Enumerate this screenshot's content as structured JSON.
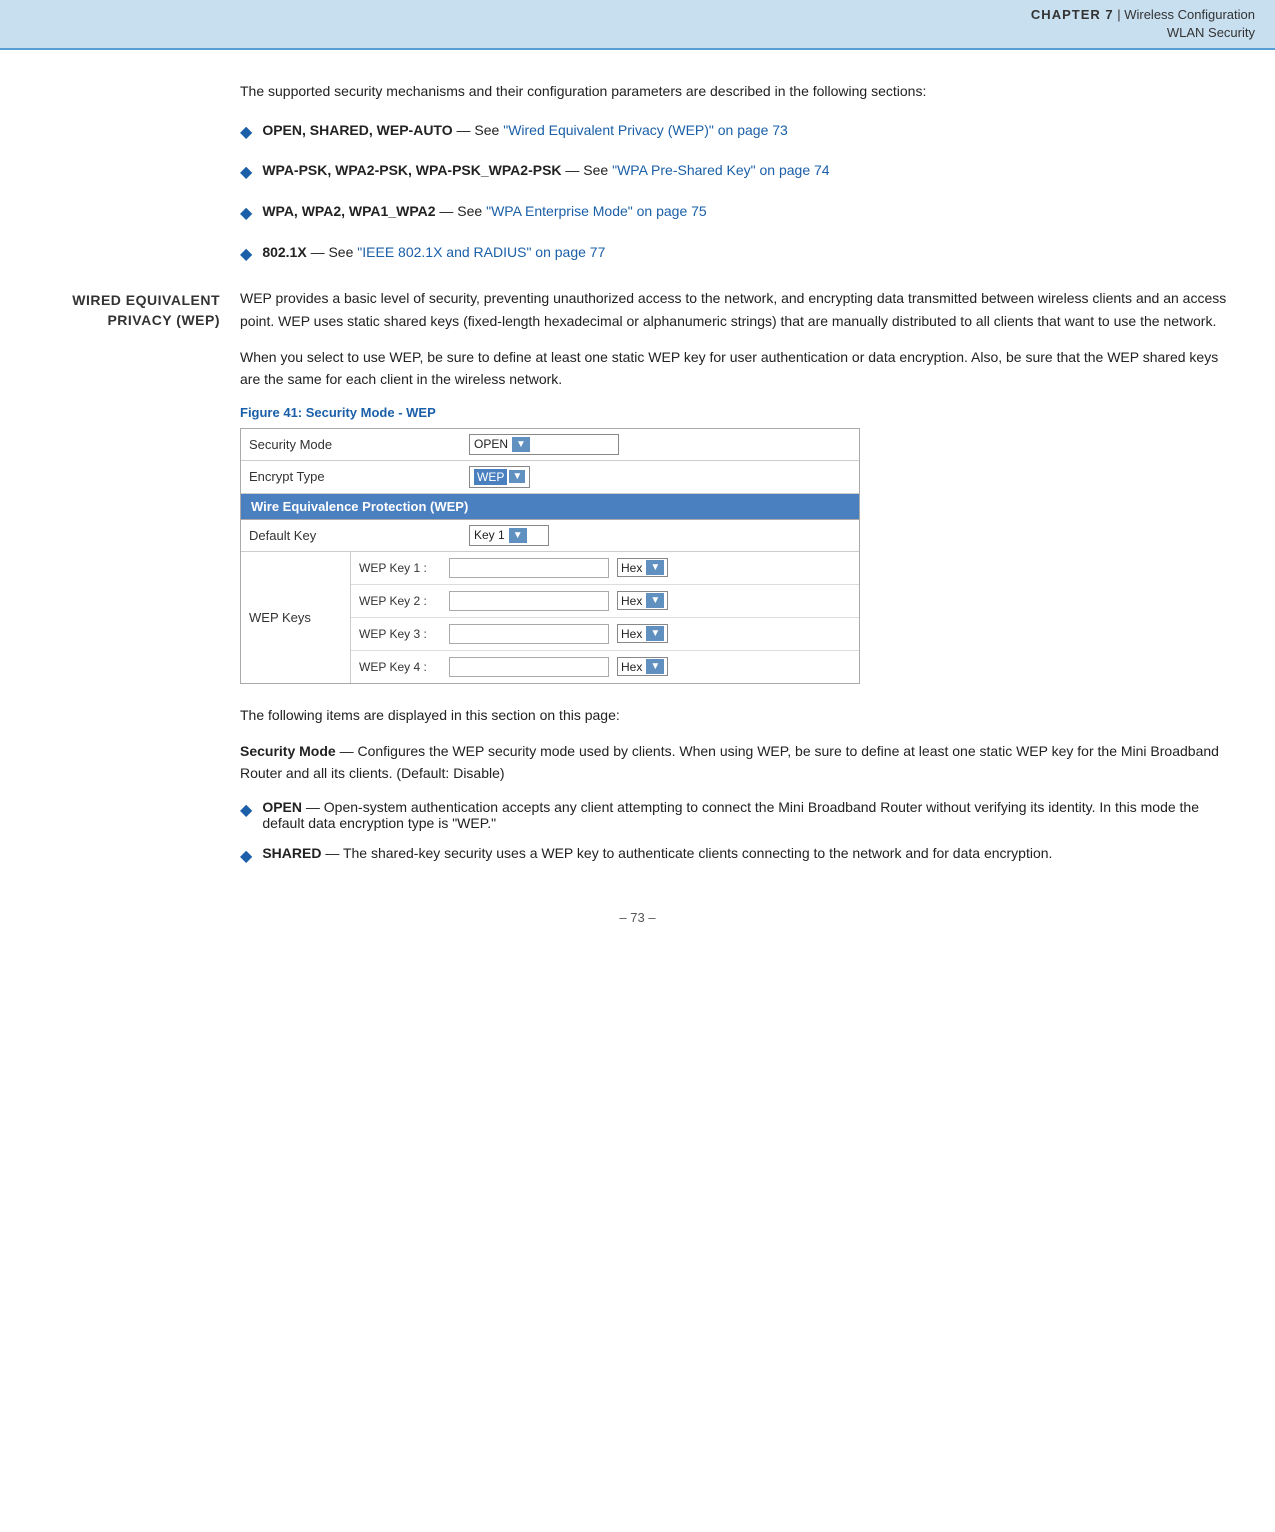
{
  "header": {
    "chapter_label": "CHAPTER 7",
    "separator": "  |  ",
    "chapter_title": "Wireless Configuration",
    "sub_title": "WLAN Security"
  },
  "intro": {
    "text": "The supported security mechanisms and their configuration parameters are described in the following sections:"
  },
  "bullet_items": [
    {
      "bold": "OPEN, SHARED, WEP-AUTO",
      "dash": " — See ",
      "link_text": "\"Wired Equivalent Privacy (WEP)\" on page 73"
    },
    {
      "bold": "WPA-PSK, WPA2-PSK, WPA-PSK_WPA2-PSK",
      "dash": " — See ",
      "link_text": "\"WPA Pre-Shared Key\" on page 74"
    },
    {
      "bold": "WPA, WPA2, WPA1_WPA2",
      "dash": " — See ",
      "link_text": "\"WPA Enterprise Mode\" on page 75"
    },
    {
      "bold": "802.1X",
      "dash": " — See ",
      "link_text": "\"IEEE 802.1X and RADIUS\" on page 77"
    }
  ],
  "section": {
    "title_line1": "Wired Equivalent",
    "title_line2": "Privacy (WEP)",
    "body1": "WEP provides a basic level of security, preventing unauthorized access to the network, and encrypting data transmitted between wireless clients and an access point. WEP uses static shared keys (fixed-length hexadecimal or alphanumeric strings) that are manually distributed to all clients that want to use the network.",
    "body2": "When you select to use WEP, be sure to define at least one static WEP key for user authentication or data encryption. Also, be sure that the WEP shared keys are the same for each client in the wireless network.",
    "figure_caption": "Figure 41:  Security Mode - WEP",
    "wep_table": {
      "security_mode_label": "Security Mode",
      "security_mode_value": "OPEN",
      "encrypt_type_label": "Encrypt Type",
      "encrypt_type_value": "WEP",
      "wep_section_header": "Wire Equivalence Protection (WEP)",
      "default_key_label": "Default Key",
      "default_key_value": "Key 1",
      "wep_keys_label": "WEP Keys",
      "keys": [
        {
          "name": "WEP Key 1 :"
        },
        {
          "name": "WEP Key 2 :"
        },
        {
          "name": "WEP Key 3 :"
        },
        {
          "name": "WEP Key 4 :"
        }
      ],
      "hex_label": "Hex"
    },
    "following_text": "The following items are displayed in this section on this page:",
    "security_mode_desc_bold": "Security Mode",
    "security_mode_desc": " — Configures the WEP security mode used by clients. When using WEP, be sure to define at least one static WEP key for the Mini Broadband Router and all its clients. (Default: Disable)",
    "open_bold": "OPEN",
    "open_desc": " — Open-system authentication accepts any client attempting to connect the Mini Broadband Router without verifying its identity. In this mode the default data encryption type is \"WEP.\"",
    "shared_bold": "SHARED",
    "shared_desc": " — The shared-key security uses a WEP key to authenticate clients connecting to the network and for data encryption."
  },
  "footer": {
    "text": "–  73  –"
  },
  "colors": {
    "header_bg": "#c8dff0",
    "header_border": "#5a9fd4",
    "link_color": "#1a5fa8",
    "section_header_bg": "#4a7fc0",
    "bullet_color": "#1a5fa8",
    "section_title_color": "#333"
  }
}
